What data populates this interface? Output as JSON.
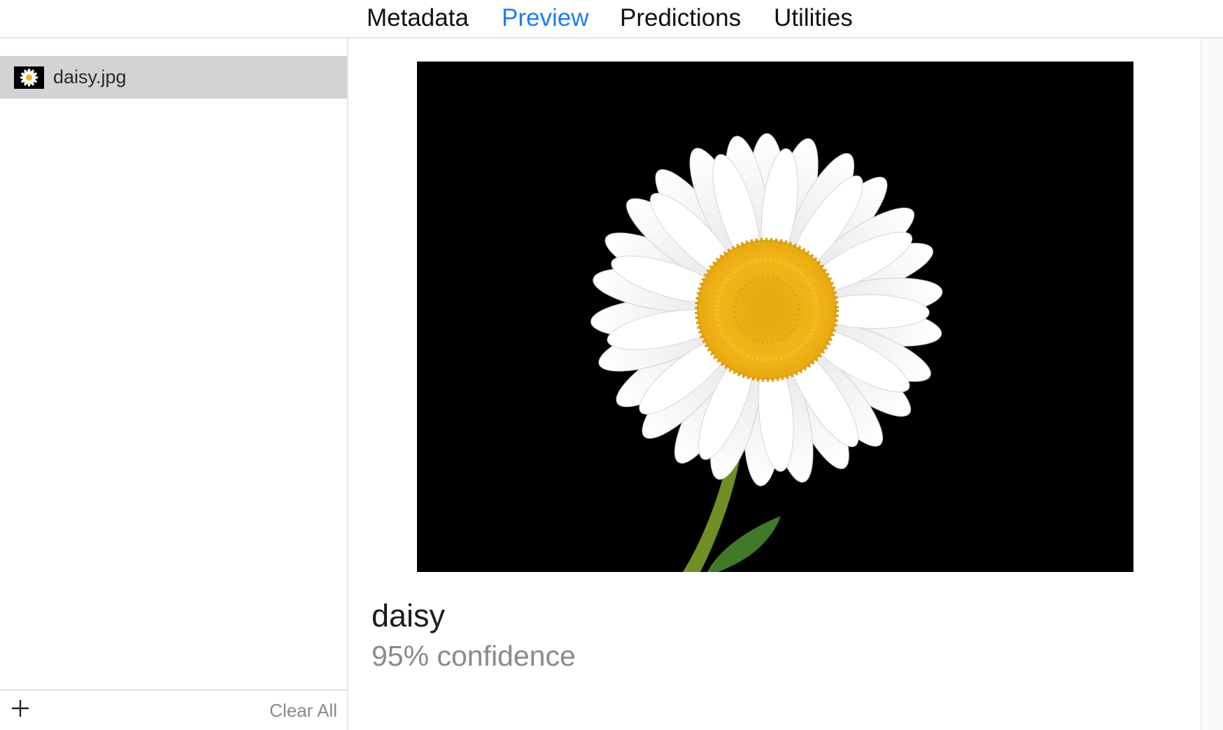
{
  "tabs": [
    {
      "label": "Metadata",
      "active": false
    },
    {
      "label": "Preview",
      "active": true
    },
    {
      "label": "Predictions",
      "active": false
    },
    {
      "label": "Utilities",
      "active": false
    }
  ],
  "sidebar": {
    "files": [
      {
        "name": "daisy.jpg",
        "selected": true
      }
    ],
    "footer": {
      "add_icon": "plus-icon",
      "clear_label": "Clear All"
    }
  },
  "preview": {
    "image_subject": "daisy-flower-image",
    "prediction_label": "daisy",
    "confidence_text": "95% confidence"
  },
  "colors": {
    "accent": "#1a7ef5",
    "selection": "#d2d3d5",
    "secondary_text": "#8a8a8a"
  }
}
